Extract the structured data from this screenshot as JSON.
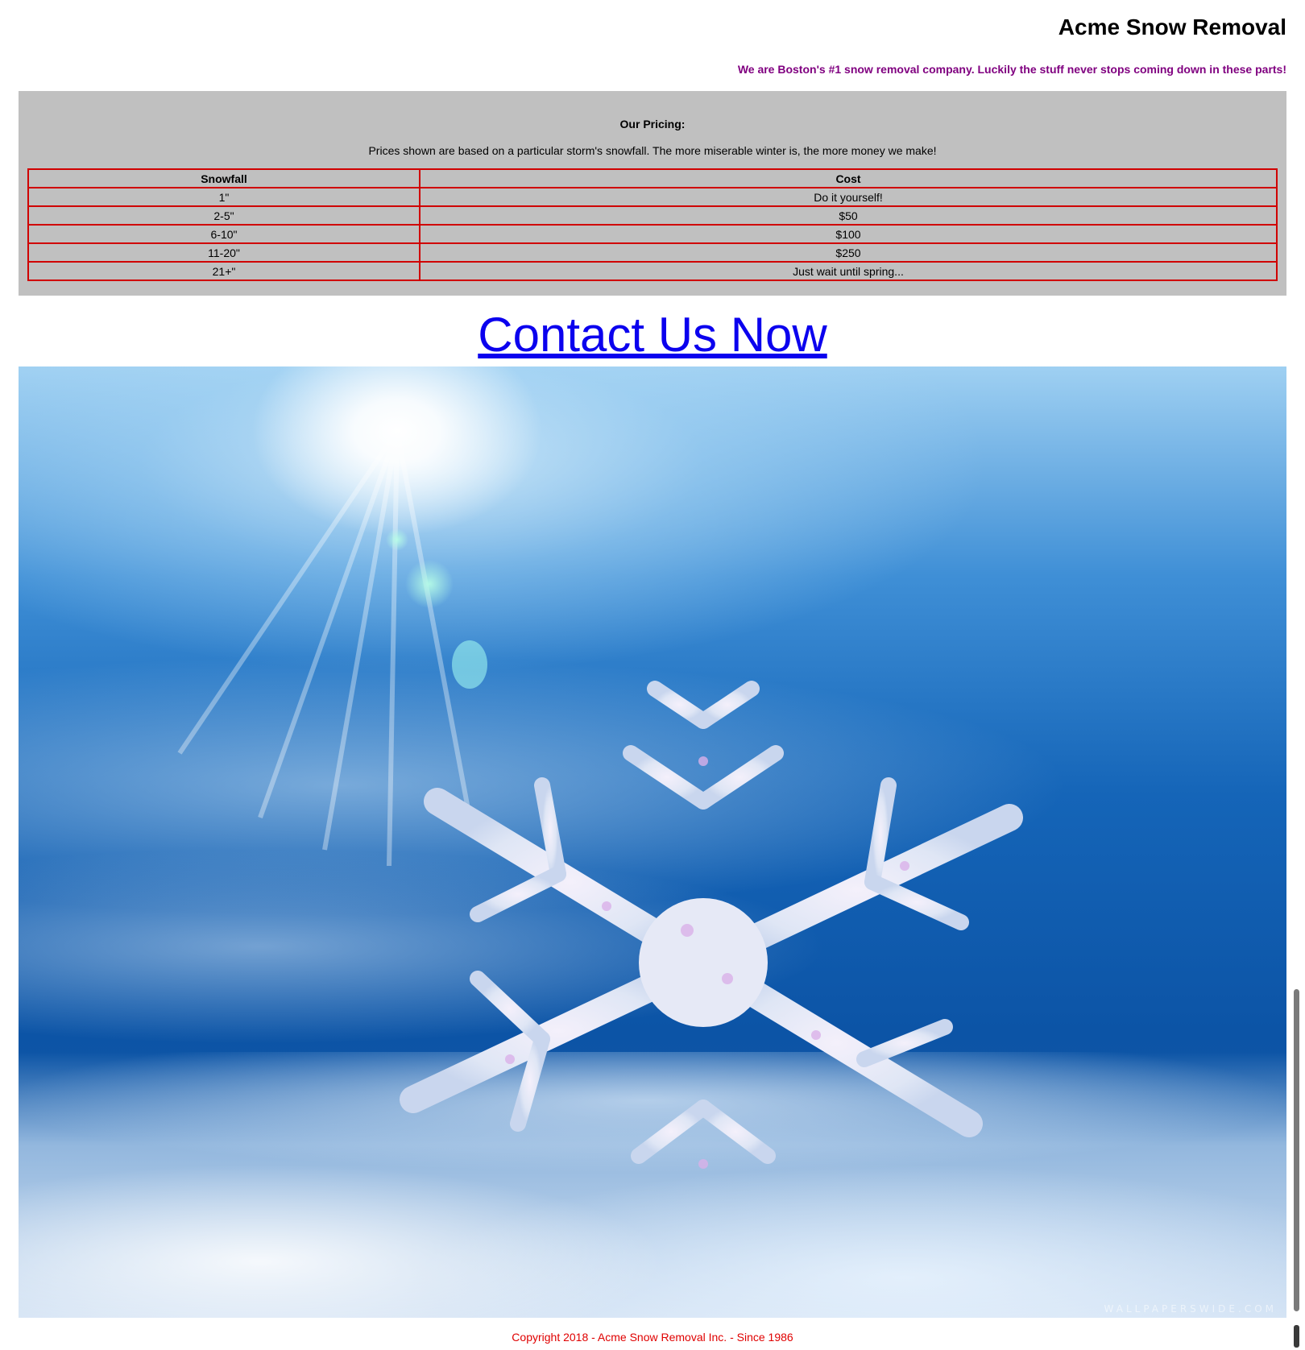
{
  "header": {
    "title": "Acme Snow Removal",
    "tagline": "We are Boston's #1 snow removal company. Luckily the stuff never stops coming down in these parts!"
  },
  "pricing": {
    "heading": "Our Pricing:",
    "description": "Prices shown are based on a particular storm's snowfall. The more miserable winter is, the more money we make!",
    "columns": [
      "Snowfall",
      "Cost"
    ],
    "rows": [
      {
        "snowfall": "1\"",
        "cost": "Do it yourself!"
      },
      {
        "snowfall": "2-5\"",
        "cost": "$50"
      },
      {
        "snowfall": "6-10\"",
        "cost": "$100"
      },
      {
        "snowfall": "11-20\"",
        "cost": "$250"
      },
      {
        "snowfall": "21+\"",
        "cost": "Just wait until spring..."
      }
    ]
  },
  "contact": {
    "label": "Contact Us Now"
  },
  "hero": {
    "watermark": "WALLPAPERSWIDE.COM"
  },
  "footer": {
    "copyright": "Copyright 2018 - Acme Snow Removal Inc. - Since 1986"
  },
  "colors": {
    "tagline": "#800080",
    "pricing_bg": "#c0c0c0",
    "table_border": "#d00000",
    "link": "#0b00ee",
    "footer": "#e00000"
  }
}
